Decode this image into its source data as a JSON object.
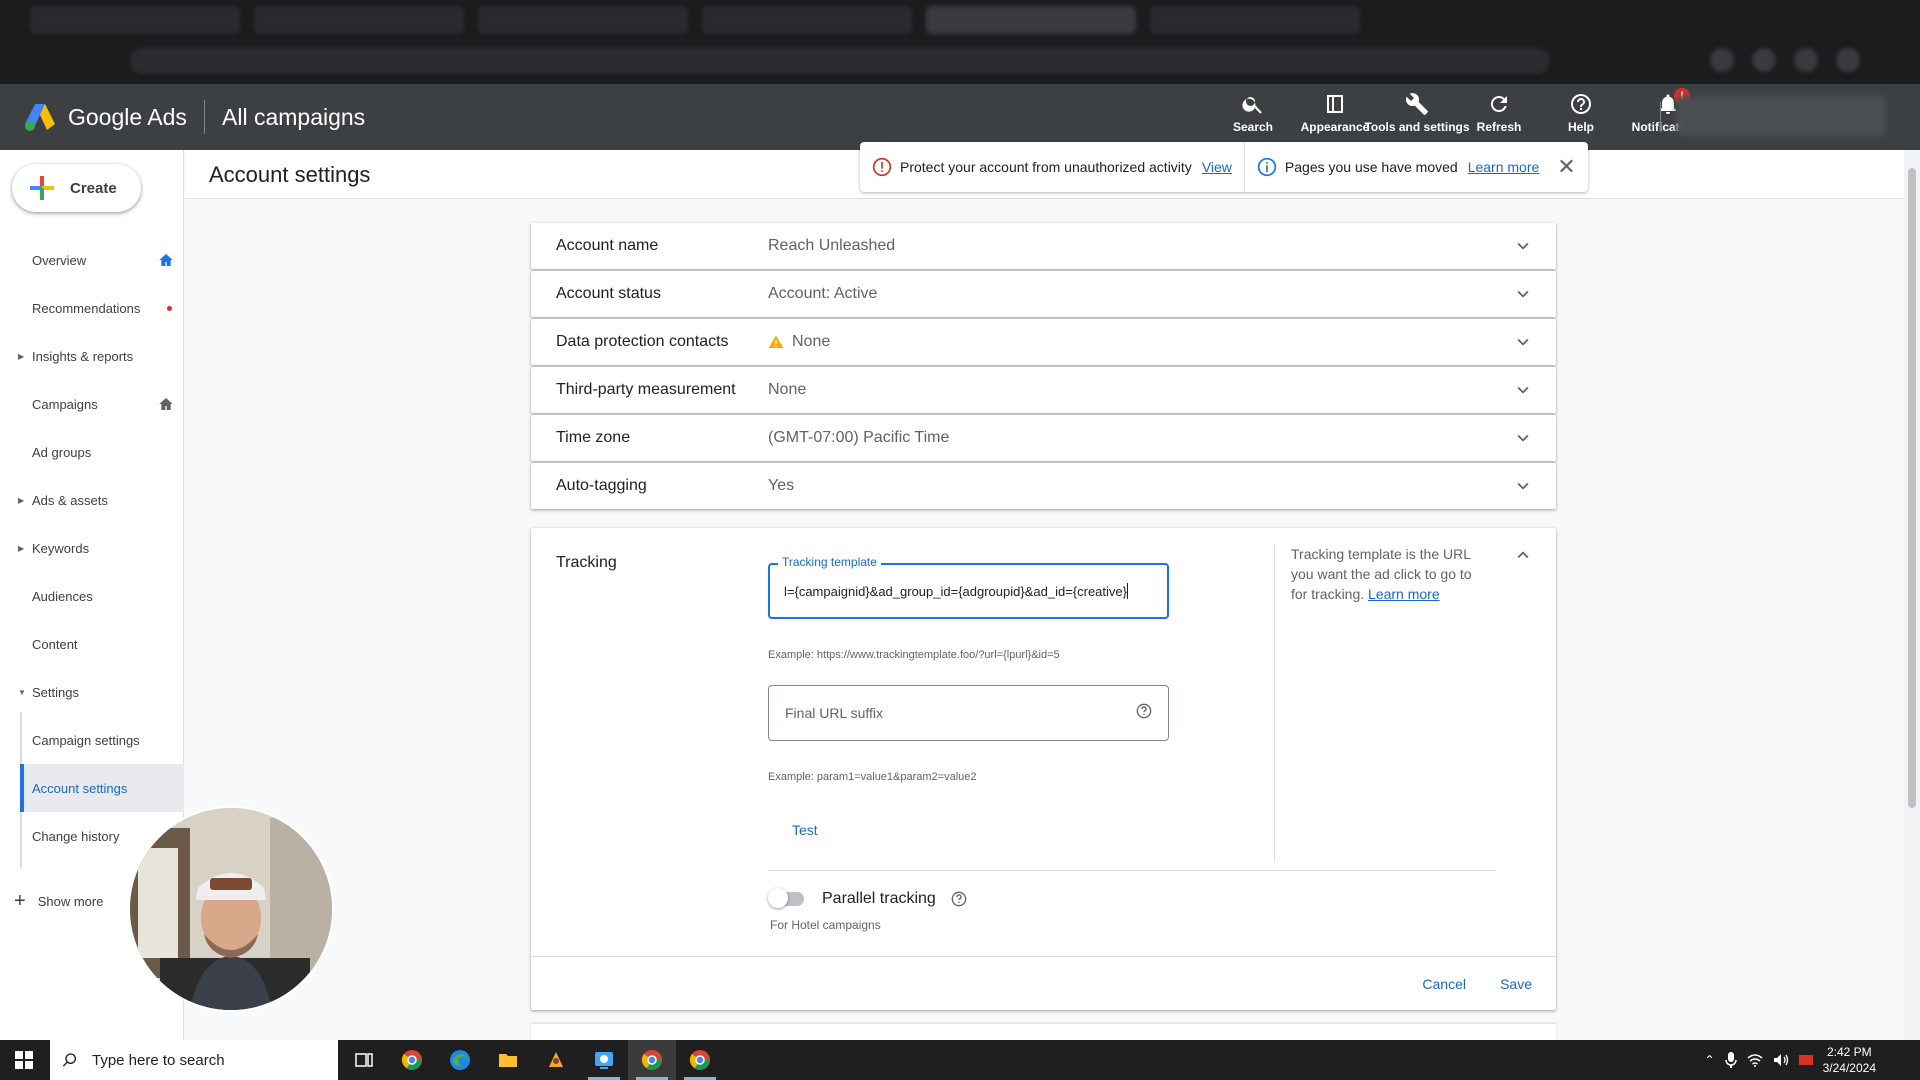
{
  "header": {
    "brand": "Google Ads",
    "section": "All campaigns",
    "tools": [
      {
        "label": "Search"
      },
      {
        "label": "Appearance"
      },
      {
        "label": "Tools and settings"
      },
      {
        "label": "Refresh"
      },
      {
        "label": "Help"
      },
      {
        "label": "Notifications",
        "badge": "!"
      }
    ]
  },
  "sidebar": {
    "create_label": "Create",
    "items": [
      {
        "label": "Overview"
      },
      {
        "label": "Recommendations"
      },
      {
        "label": "Insights & reports"
      },
      {
        "label": "Campaigns"
      },
      {
        "label": "Ad groups"
      },
      {
        "label": "Ads & assets"
      },
      {
        "label": "Keywords"
      },
      {
        "label": "Audiences"
      },
      {
        "label": "Content"
      },
      {
        "label": "Settings"
      },
      {
        "label": "Campaign settings"
      },
      {
        "label": "Account settings"
      },
      {
        "label": "Change history"
      }
    ],
    "show_more": "Show more"
  },
  "page": {
    "title": "Account settings"
  },
  "alerts": {
    "protect_text": "Protect your account from unauthorized activity",
    "protect_link": "View",
    "moved_text": "Pages you use have moved",
    "moved_link": "Learn more"
  },
  "settings": [
    {
      "label": "Account name",
      "value": "Reach Unleashed"
    },
    {
      "label": "Account status",
      "value": "Account: Active"
    },
    {
      "label": "Data protection contacts",
      "value": "None"
    },
    {
      "label": "Third-party measurement",
      "value": "None"
    },
    {
      "label": "Time zone",
      "value": "(GMT-07:00) Pacific Time"
    },
    {
      "label": "Auto-tagging",
      "value": "Yes"
    }
  ],
  "tracking": {
    "label": "Tracking",
    "template_label": "Tracking template",
    "template_value": "l={campaignid}&ad_group_id={adgroupid}&ad_id={creative}",
    "template_example": "Example: https://www.trackingtemplate.foo/?url={lpurl}&id=5",
    "suffix_placeholder": "Final URL suffix",
    "suffix_example": "Example: param1=value1&param2=value2",
    "test_label": "Test",
    "help_text": "Tracking template is the URL you want the ad click to go to for tracking.",
    "help_link": "Learn more",
    "parallel_label": "Parallel tracking",
    "parallel_sub": "For Hotel campaigns",
    "cancel_label": "Cancel",
    "save_label": "Save"
  },
  "taskbar": {
    "search_placeholder": "Type here to search",
    "time": "2:42 PM",
    "date": "3/24/2024"
  },
  "colors": {
    "header_bg": "#3c4043",
    "accent": "#1a73e8",
    "link": "#1967d2",
    "warning": "#f9ab00",
    "error": "#d93025"
  }
}
